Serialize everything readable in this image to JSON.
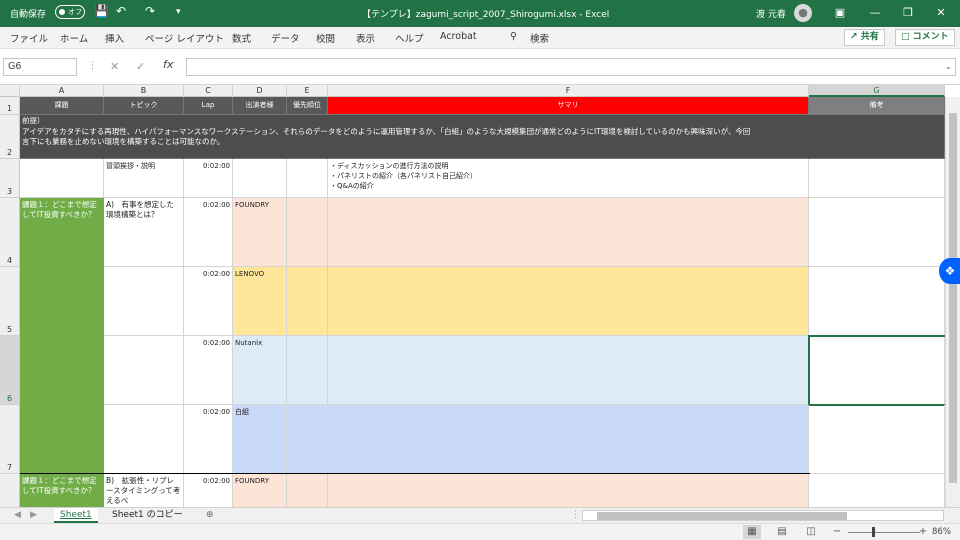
{
  "titlebar": {
    "autosave_label": "自動保存",
    "autosave_state": "オフ",
    "file_title": "【テンプレ】zagumi_script_2007_Shirogumi.xlsx  -  Excel",
    "user_name": "渡 元春"
  },
  "ribbon": {
    "tabs": [
      "ファイル",
      "ホーム",
      "挿入",
      "ページ レイアウト",
      "数式",
      "データ",
      "校閲",
      "表示",
      "ヘルプ",
      "Acrobat"
    ],
    "search_label": "検索",
    "share_label": "共有",
    "comment_label": "コメント"
  },
  "formula_bar": {
    "name_box": "G6",
    "formula": "",
    "fx_label": "fx"
  },
  "columns": [
    "A",
    "B",
    "C",
    "D",
    "E",
    "F",
    "G"
  ],
  "rows": [
    "1",
    "2",
    "3",
    "4",
    "5",
    "6",
    "7"
  ],
  "sheet": {
    "header": {
      "a": "課題",
      "b": "トピック",
      "c": "Lap",
      "d": "出演者様",
      "e": "優先順位",
      "f": "サマリ",
      "g": "備考"
    },
    "premise": "前提）\nアイデアをカタチにする再現性、ハイパフォーマンスなワークステーション、それらのデータをどのように運用管理するか、「白組」のような大規模集団が通常どのようにIT環境を検討しているのかも興味深いが、今回\n言下にも業務を止めない環境を構築することは可能なのか。",
    "row3": {
      "b": "冒頭挨拶・説明",
      "c": "0:02:00",
      "f": "・ディスカッションの進行方法の説明\n・パネリストの紹介（各パネリスト自己紹介）\n・Q&Aの紹介"
    },
    "row4": {
      "a": "課題１：どこまで想定してIT投資すべきか？",
      "b": "A)　有事を想定した環境構築とは？",
      "c": "0:02:00",
      "d": "FOUNDRY"
    },
    "row5": {
      "c": "0:02:00",
      "d": "LENOVO"
    },
    "row6": {
      "c": "0:02:00",
      "d": "Nutanix"
    },
    "row7": {
      "c": "0:02:00",
      "d": "白組"
    },
    "row8": {
      "a": "課題１：どこまで想定してIT投資すべきか？",
      "b": "B)　拡張性・リプレースタイミングって考えるべ",
      "c": "0:02:00",
      "d": "FOUNDRY"
    }
  },
  "sheet_tabs": [
    "Sheet1",
    "Sheet1 のコピー"
  ],
  "status": {
    "zoom": "86%"
  },
  "colors": {
    "excel_green": "#217346",
    "header_red": "#ff0000",
    "task_green": "#70ad47"
  }
}
